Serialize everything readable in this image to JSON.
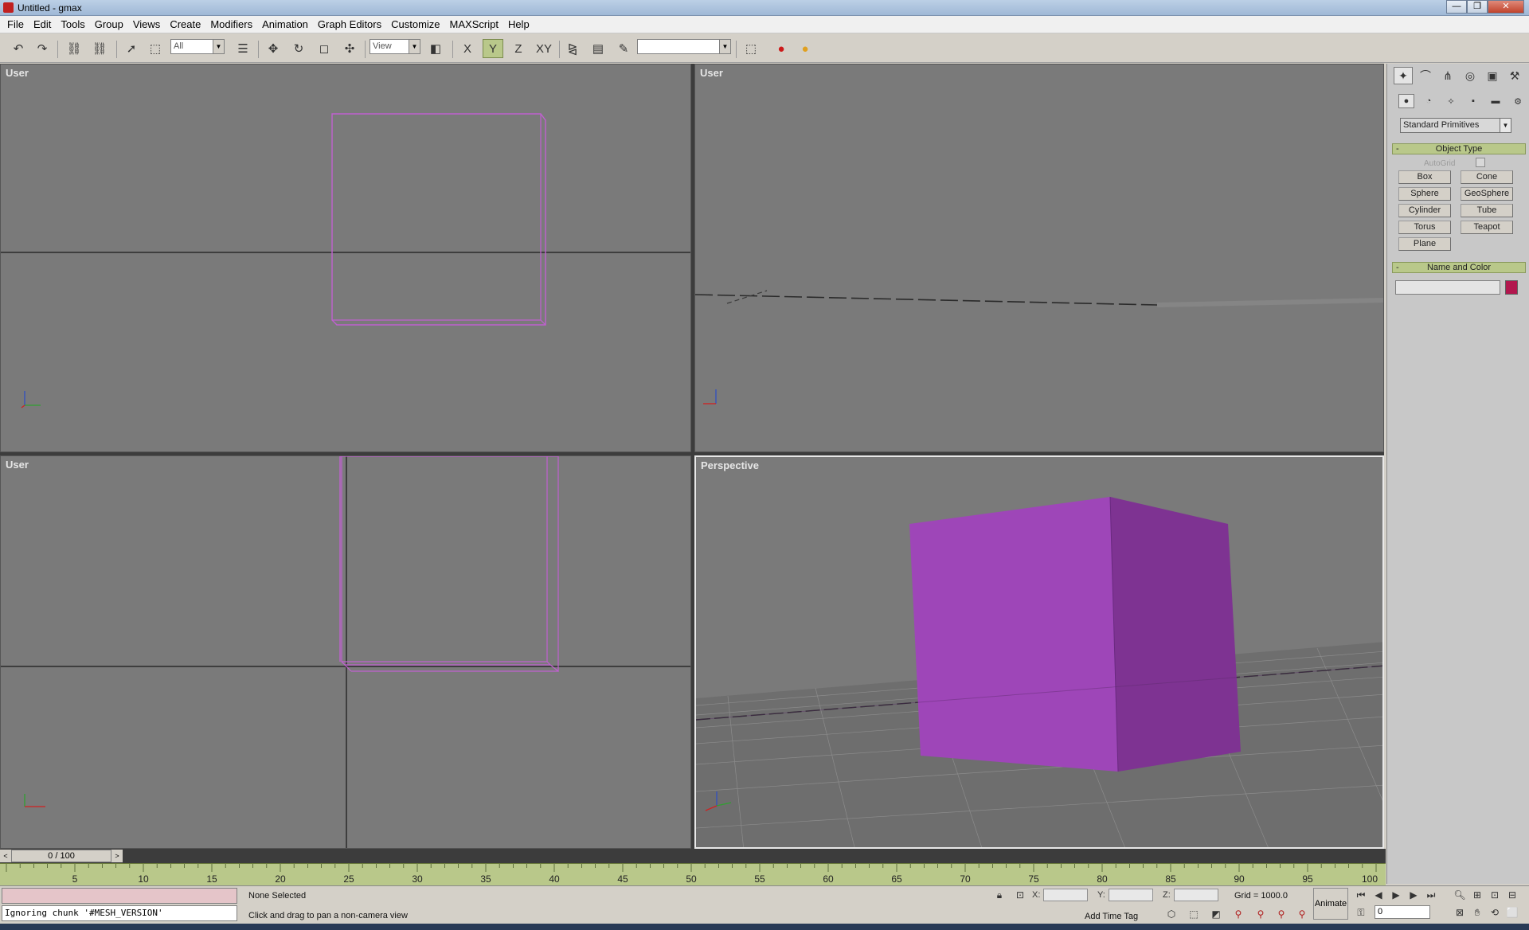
{
  "window": {
    "title": "Untitled - gmax",
    "buttons": [
      "—",
      "❐",
      "✕"
    ]
  },
  "menu": [
    "File",
    "Edit",
    "Tools",
    "Group",
    "Views",
    "Create",
    "Modifiers",
    "Animation",
    "Graph Editors",
    "Customize",
    "MAXScript",
    "Help"
  ],
  "toolbar": {
    "selection_filter": "All",
    "reference_coord": "View",
    "axis_x": "X",
    "axis_y": "Y",
    "axis_z": "Z",
    "axis_xy": "XY",
    "named_selection": ""
  },
  "viewports": [
    {
      "label": "User",
      "axis1": "z",
      "axis2": "y",
      "axis3": "x"
    },
    {
      "label": "User",
      "axis1": "z",
      "axis2": "x",
      "axis3": ""
    },
    {
      "label": "User",
      "axis1": "y",
      "axis2": "x",
      "axis3": ""
    },
    {
      "label": "Perspective",
      "axis1": "z",
      "axis2": "y",
      "axis3": "x"
    }
  ],
  "command_panel": {
    "category": "Standard Primitives",
    "object_type_title": "Object Type",
    "autogrid_label": "AutoGrid",
    "primitives": [
      "Box",
      "Cone",
      "Sphere",
      "GeoSphere",
      "Cylinder",
      "Tube",
      "Torus",
      "Teapot",
      "Plane"
    ],
    "name_color_title": "Name and Color",
    "object_color": "#b2174e"
  },
  "time_slider": {
    "position": "0 / 100"
  },
  "trackbar": {
    "ticks": [
      "5",
      "10",
      "15",
      "20",
      "25",
      "30",
      "35",
      "40",
      "45",
      "50",
      "55",
      "60",
      "65",
      "70",
      "75",
      "80",
      "85",
      "90",
      "95",
      "100"
    ]
  },
  "status": {
    "listener_output": "Ignoring chunk '#MESH_VERSION'",
    "selection": "None Selected",
    "prompt": "Click and drag to pan a non-camera view",
    "x_label": "X:",
    "y_label": "Y:",
    "z_label": "Z:",
    "grid": "Grid = 1000.0",
    "add_time_tag": "Add Time Tag",
    "animate": "Animate",
    "current_frame": "0"
  },
  "colors": {
    "viewport_bg": "#7a7a7a",
    "object_wire": "#c060d0",
    "cube_front": "#9e46b8",
    "cube_side": "#7e3392",
    "trackbar": "#b9c88a"
  }
}
